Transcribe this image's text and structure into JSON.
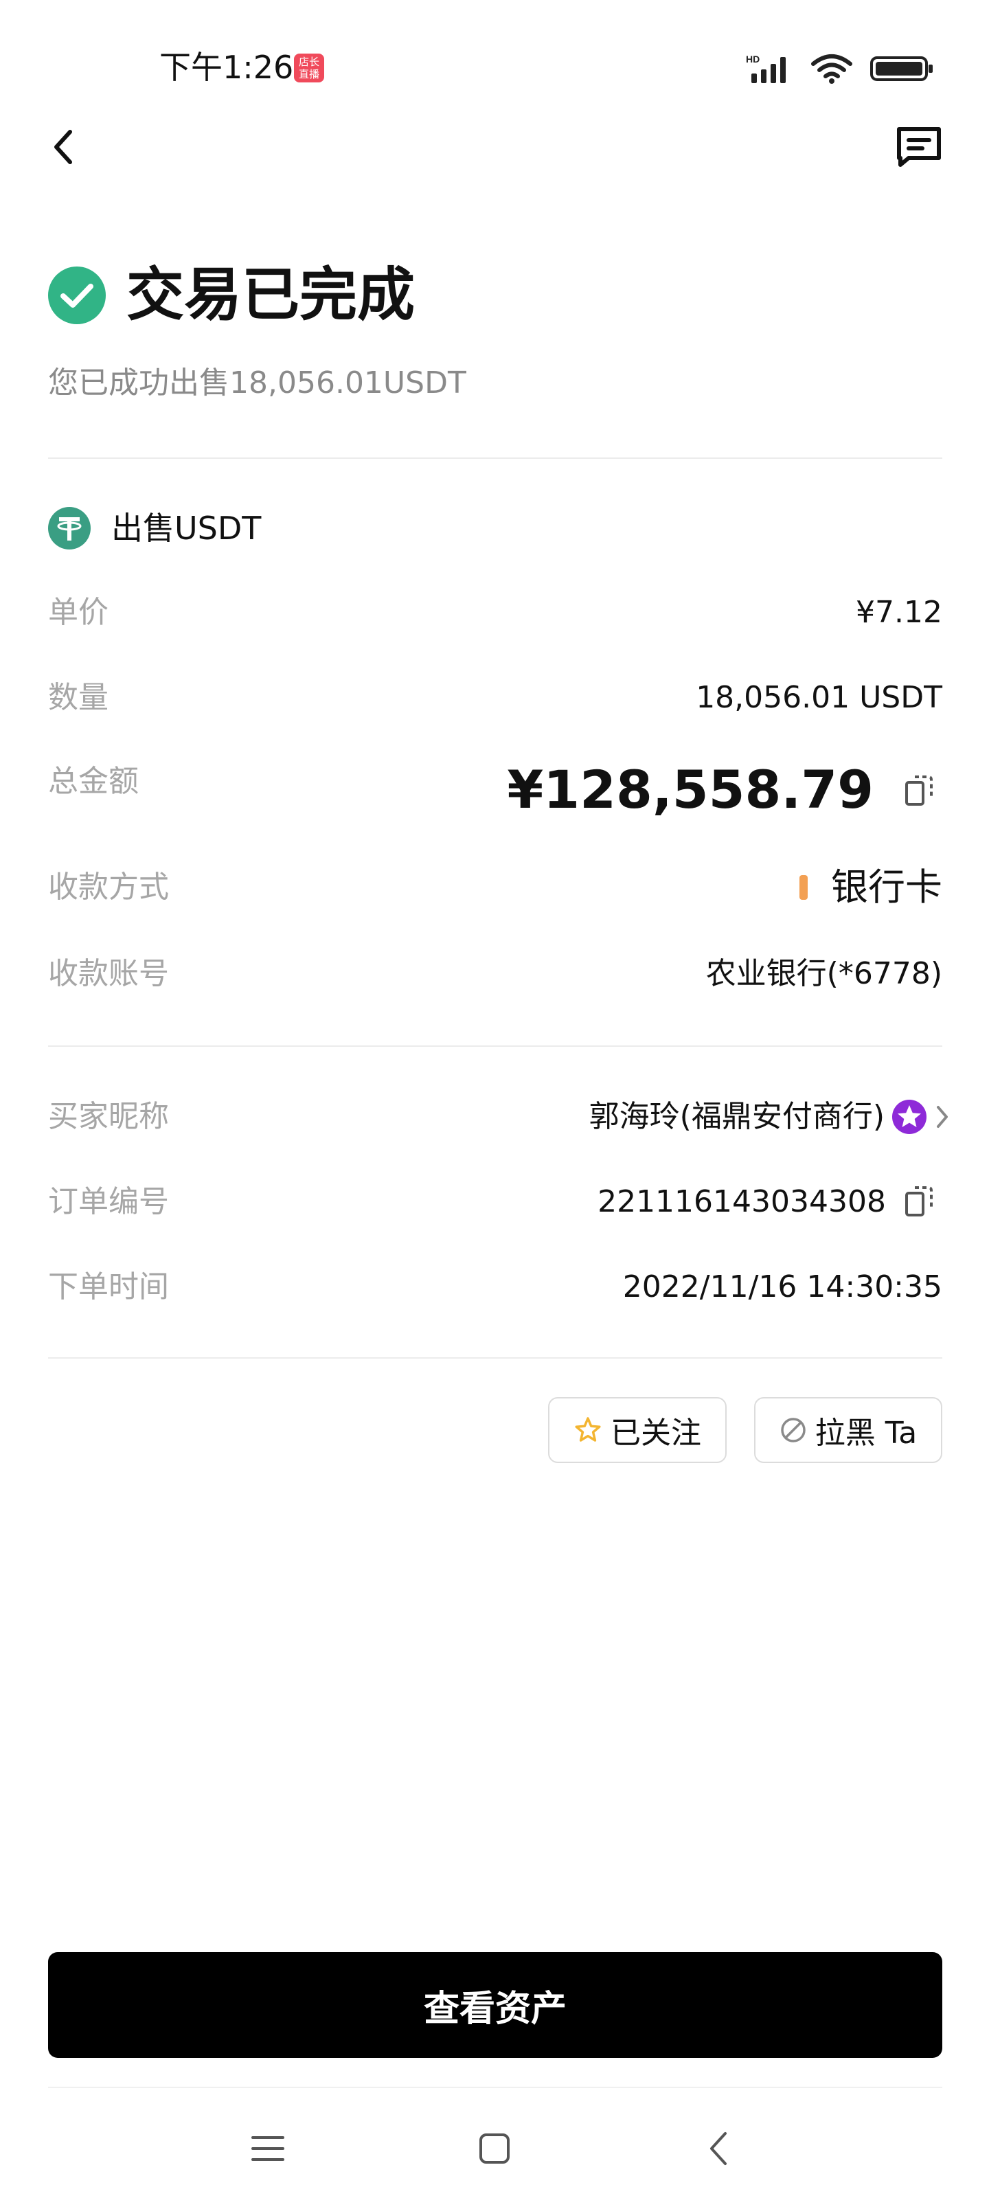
{
  "status_bar": {
    "time": "下午1:26",
    "live_badge_line1": "店长",
    "live_badge_line2": "直播",
    "hd_label": "HD",
    "icons": [
      "signal-icon",
      "wifi-icon",
      "battery-icon"
    ]
  },
  "header": {
    "back_icon": "chevron-left-icon",
    "chat_icon": "chat-icon"
  },
  "status": {
    "title": "交易已完成",
    "subtitle": "您已成功出售18,056.01USDT",
    "icon": "check-circle-icon",
    "color": "#31b486"
  },
  "order": {
    "coin_title": "出售USDT",
    "coin_color": "#3a9e83",
    "rows": [
      {
        "label": "单价",
        "value": "¥7.12"
      },
      {
        "label": "数量",
        "value": "18,056.01 USDT"
      },
      {
        "label": "总金额",
        "value": "¥128,558.79"
      },
      {
        "label": "收款方式",
        "value": "银行卡"
      },
      {
        "label": "收款账号",
        "value": "农业银行(*6778)"
      }
    ],
    "method_color": "#f3a053"
  },
  "details": {
    "rows": [
      {
        "label": "买家昵称",
        "value": "郭海玲(福鼎安付商行)"
      },
      {
        "label": "订单编号",
        "value": "221116143034308"
      },
      {
        "label": "下单时间",
        "value": "2022/11/16 14:30:35"
      }
    ],
    "badge_color": "#8e2ad8"
  },
  "actions": {
    "follow_label": "已关注",
    "block_label": "拉黑 Ta",
    "follow_icon_color": "#f3b531"
  },
  "main_button": {
    "label": "查看资产"
  },
  "nav_bar": {
    "icons": [
      "menu-icon",
      "home-square-icon",
      "back-triangle-icon"
    ]
  }
}
